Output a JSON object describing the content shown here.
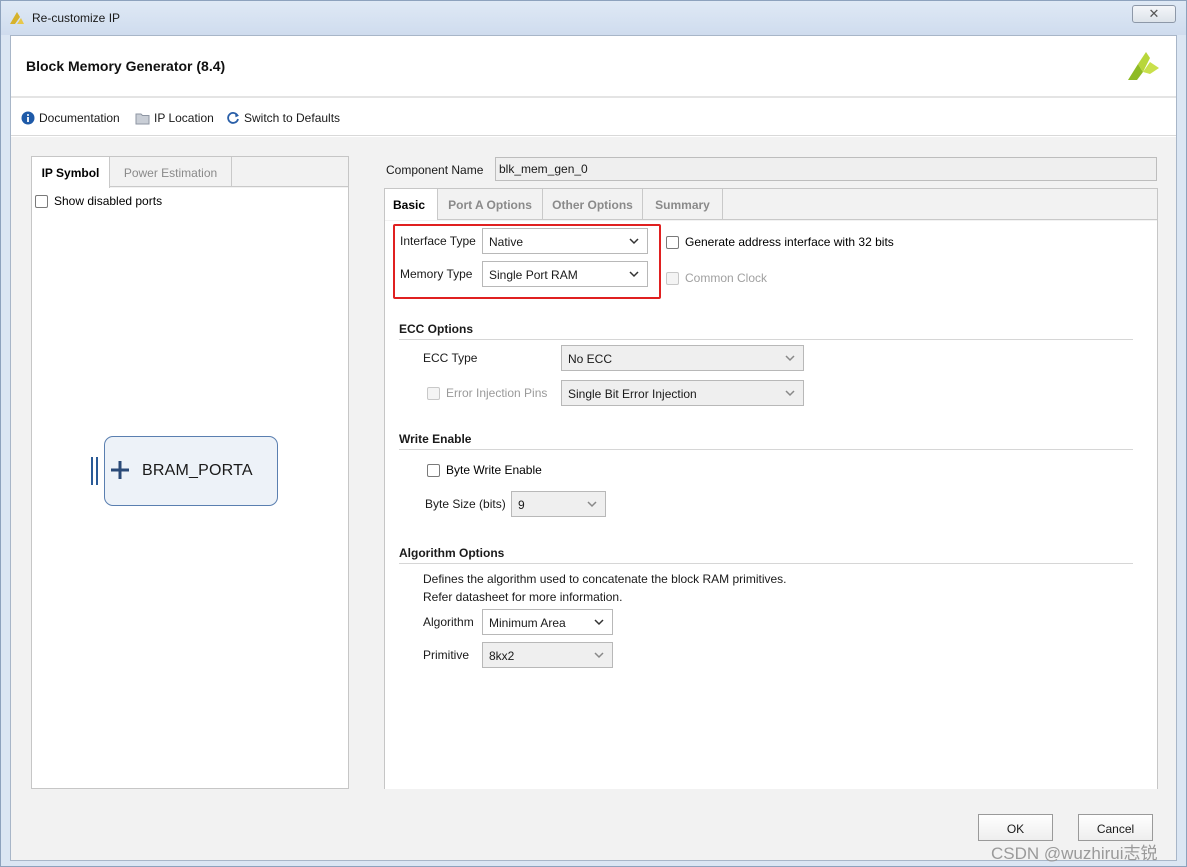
{
  "window": {
    "title": "Re-customize IP",
    "close_label": "✕"
  },
  "header": {
    "title": "Block Memory Generator (8.4)",
    "logo_icon": "xilinx-logo-icon"
  },
  "toolbar": {
    "documentation": "Documentation",
    "ip_location": "IP Location",
    "switch_defaults": "Switch to Defaults"
  },
  "left_panel": {
    "tabs": [
      "IP Symbol",
      "Power Estimation"
    ],
    "show_disabled_ports": "Show disabled ports",
    "symbol_port_label": "BRAM_PORTA"
  },
  "component": {
    "label": "Component Name",
    "value": "blk_mem_gen_0"
  },
  "right_panel": {
    "tabs": [
      "Basic",
      "Port A Options",
      "Other Options",
      "Summary"
    ],
    "interface_type": {
      "label": "Interface Type",
      "value": "Native"
    },
    "memory_type": {
      "label": "Memory Type",
      "value": "Single Port RAM"
    },
    "generate_address": "Generate address interface with 32 bits",
    "common_clock": "Common Clock",
    "ecc": {
      "title": "ECC Options",
      "type_label": "ECC Type",
      "type_value": "No ECC",
      "error_injection_label": "Error Injection Pins",
      "error_injection_value": "Single Bit Error Injection"
    },
    "write_enable": {
      "title": "Write Enable",
      "byte_write_enable": "Byte Write Enable",
      "byte_size_label": "Byte Size (bits)",
      "byte_size_value": "9"
    },
    "algorithm": {
      "title": "Algorithm Options",
      "desc_line1": "Defines the algorithm used to concatenate the block RAM primitives.",
      "desc_line2": "Refer datasheet for more information.",
      "algorithm_label": "Algorithm",
      "algorithm_value": "Minimum Area",
      "primitive_label": "Primitive",
      "primitive_value": "8kx2"
    }
  },
  "footer": {
    "ok": "OK",
    "cancel": "Cancel"
  },
  "watermark": "CSDN @wuzhirui志锐",
  "colors": {
    "highlight_border": "#e02020",
    "symbol_border": "#5a7fb0",
    "symbol_fill": "#edf2f8"
  }
}
